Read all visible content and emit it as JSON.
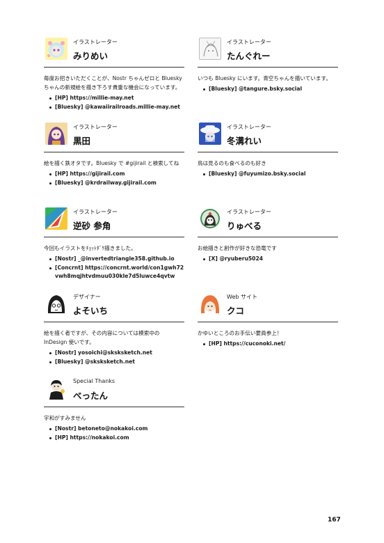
{
  "page_number": "167",
  "cards": {
    "mirimei": {
      "role": "イラストレーター",
      "name": "みりめい",
      "desc": "毎度お招きいただくことが、Nostr ちゃんゼロと Bluesky ちゃんの新規絵を描き下ろす貴重な機会になっています。",
      "links": [
        "[HP] https://millie-may.net",
        "[Bluesky] @kawaiirailroads.millie-may.net"
      ],
      "icon": "anime-girl-avatar-icon"
    },
    "tangure": {
      "role": "イラストレーター",
      "name": "たんぐれー",
      "desc": "いつも Bluesky にいます。青空ちゃんを描いています。",
      "links": [
        "[Bluesky] @tangure.bsky.social"
      ],
      "icon": "pencil-sketch-avatar-icon"
    },
    "kuroda": {
      "role": "イラストレーター",
      "name": "黒田",
      "desc": "絵を描く鉄オタです。Bluesky で #gijirail と検索してね",
      "links": [
        "[HP] https://gijirail.com",
        "[Bluesky] @krdrailway.gijirail.com"
      ],
      "icon": "purple-hair-avatar-icon"
    },
    "fuyumizo": {
      "role": "イラストレーター",
      "name": "冬溝れい",
      "desc": "鳥は見るのも食べるのも好き",
      "links": [
        "[Bluesky] @fuyumizo.bsky.social"
      ],
      "icon": "white-hat-avatar-icon"
    },
    "sakasuna": {
      "role": "イラストレーター",
      "name": "逆砂 参角",
      "desc": "今回もイラストをﾁｮｯﾄﾀﾞｹ描きました。",
      "links": [
        "[Nostr] _@invertedtriangle358.github.io",
        "[Concrnt] https://concrnt.world/con1gwh72vwh8mqjhtvdmuu030kle7d5luwce4qvtw"
      ],
      "icon": "rainbow-triangle-avatar-icon"
    },
    "ryuberu": {
      "role": "イラストレーター",
      "name": "りゅべる",
      "desc": "お絵描きと創作が好きな恐竜です",
      "links": [
        "[X] @ryuberu5024"
      ],
      "icon": "dinosaur-avatar-icon"
    },
    "yosoichi": {
      "role": "デザイナー",
      "name": "よそいち",
      "desc": "絵を描く者ですが、その内容については模索中の InDesign 使いです。",
      "links": [
        "[Nostr] yosoichi@sksksketch.net",
        "[Bluesky] @sksksketch.net"
      ],
      "icon": "manga-face-avatar-icon"
    },
    "kuko": {
      "role": "Web サイト",
      "name": "クコ",
      "desc": "かゆいところのお手伝い要員参上！",
      "links": [
        "[HP] https://cuconoki.net/"
      ],
      "icon": "orange-hair-avatar-icon"
    },
    "bettan": {
      "role": "Special Thanks",
      "name": "べったん",
      "desc": "宇和がすみません",
      "links": [
        "[Nostr] betoneto@nokakoi.com",
        "[HP] https://nokakoi.com"
      ],
      "icon": "suited-character-avatar-icon"
    }
  }
}
